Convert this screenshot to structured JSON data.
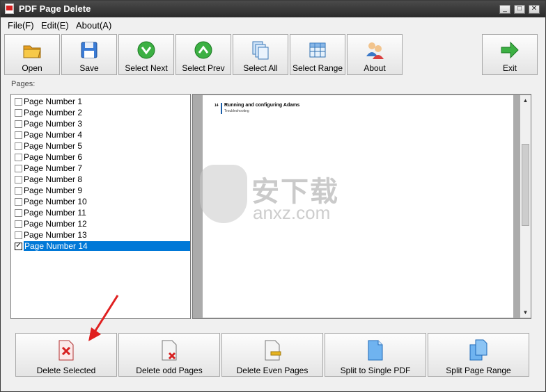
{
  "window": {
    "title": "PDF Page Delete",
    "controls": [
      "_",
      "□",
      "✕"
    ]
  },
  "menu": [
    "File(F)",
    "Edit(E)",
    "About(A)"
  ],
  "toolbar": [
    {
      "label": "Open",
      "icon": "folder-icon"
    },
    {
      "label": "Save",
      "icon": "floppy-disk-icon"
    },
    {
      "label": "Select Next",
      "icon": "green-down-arrow-icon"
    },
    {
      "label": "Select Prev",
      "icon": "green-up-arrow-icon"
    },
    {
      "label": "Select All",
      "icon": "stacked-pages-icon"
    },
    {
      "label": "Select Range",
      "icon": "table-grid-icon"
    },
    {
      "label": "About",
      "icon": "users-icon"
    },
    {
      "label": "Exit",
      "icon": "green-right-arrow-icon"
    }
  ],
  "pages_label": "Pages:",
  "pages": [
    {
      "label": "Page Number 1",
      "checked": false
    },
    {
      "label": "Page Number 2",
      "checked": false
    },
    {
      "label": "Page Number 3",
      "checked": false
    },
    {
      "label": "Page Number 4",
      "checked": false
    },
    {
      "label": "Page Number 5",
      "checked": false
    },
    {
      "label": "Page Number 6",
      "checked": false
    },
    {
      "label": "Page Number 7",
      "checked": false
    },
    {
      "label": "Page Number 8",
      "checked": false
    },
    {
      "label": "Page Number 9",
      "checked": false
    },
    {
      "label": "Page Number 10",
      "checked": false
    },
    {
      "label": "Page Number 11",
      "checked": false
    },
    {
      "label": "Page Number 12",
      "checked": false
    },
    {
      "label": "Page Number 13",
      "checked": false
    },
    {
      "label": "Page Number 14",
      "checked": true
    }
  ],
  "preview": {
    "page_number": "14",
    "heading": "Running and configuring Adams",
    "subheading": "Troubleshooting"
  },
  "watermark": {
    "chinese": "安下载",
    "domain": "anxz.com"
  },
  "bottom_buttons": [
    {
      "label": "Delete Selected",
      "icon": "page-red-x-icon"
    },
    {
      "label": "Delete odd Pages",
      "icon": "page-small-x-icon"
    },
    {
      "label": "Delete Even Pages",
      "icon": "page-minus-icon"
    },
    {
      "label": "Split to Single PDF",
      "icon": "blue-page-icon"
    },
    {
      "label": "Split Page Range",
      "icon": "blue-pages-icon"
    }
  ],
  "colors": {
    "selection": "#0078d7",
    "titlebar": "#2a2a2a",
    "arrow": "#e02020"
  }
}
